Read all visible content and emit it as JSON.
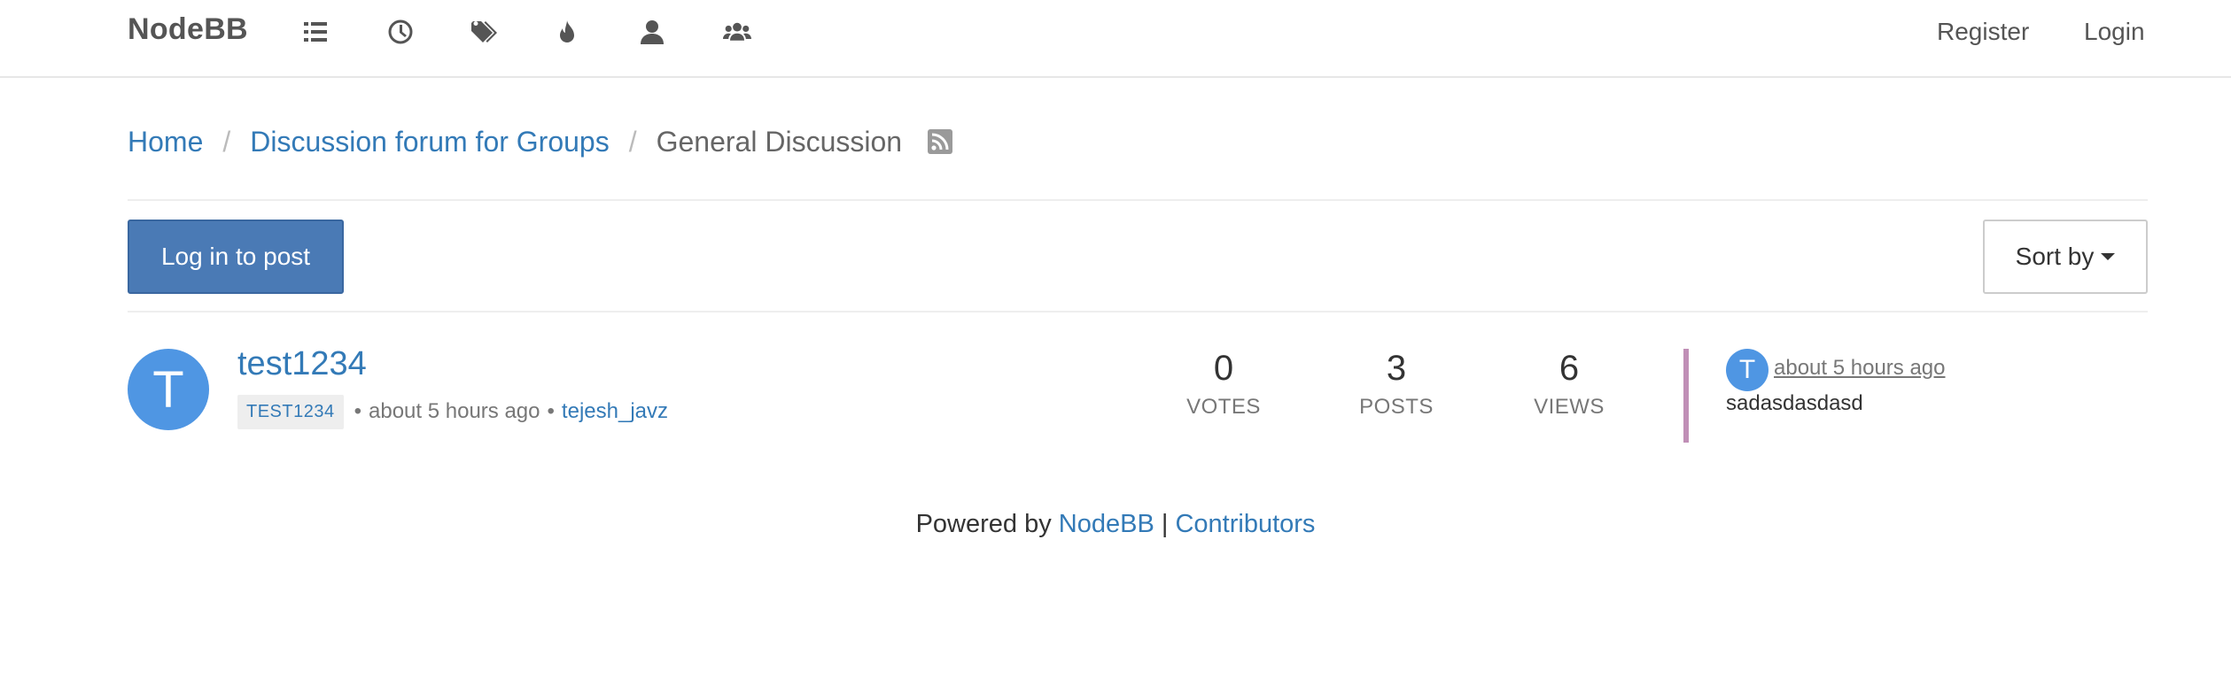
{
  "navbar": {
    "brand": "NodeBB",
    "icons": [
      {
        "name": "categories-icon"
      },
      {
        "name": "recent-icon"
      },
      {
        "name": "tags-icon"
      },
      {
        "name": "popular-icon"
      },
      {
        "name": "users-icon"
      },
      {
        "name": "groups-icon"
      }
    ],
    "register_label": "Register",
    "login_label": "Login"
  },
  "breadcrumb": {
    "home": "Home",
    "parent": "Discussion forum for Groups",
    "current": "General Discussion",
    "separator": "/",
    "rss_icon": "rss-icon"
  },
  "toolbar": {
    "post_button": "Log in to post",
    "sort_button": "Sort by"
  },
  "topic": {
    "avatar_letter": "T",
    "title": "test1234",
    "tag": "TEST1234",
    "time": "about 5 hours ago",
    "author": "tejesh_javz",
    "votes_value": "0",
    "votes_label": "VOTES",
    "posts_value": "3",
    "posts_label": "POSTS",
    "views_value": "6",
    "views_label": "VIEWS",
    "teaser": {
      "avatar_letter": "T",
      "time": "about 5 hours ago",
      "text": "sadasdasdasd"
    }
  },
  "footer": {
    "prefix": "Powered by",
    "nodebb_link": "NodeBB",
    "separator": "|",
    "contributors_link": "Contributors"
  },
  "colors": {
    "link": "#337ab7",
    "primary_button": "#4a7ab5",
    "avatar": "#4f96e3",
    "category_bar": "#c08fb6"
  }
}
